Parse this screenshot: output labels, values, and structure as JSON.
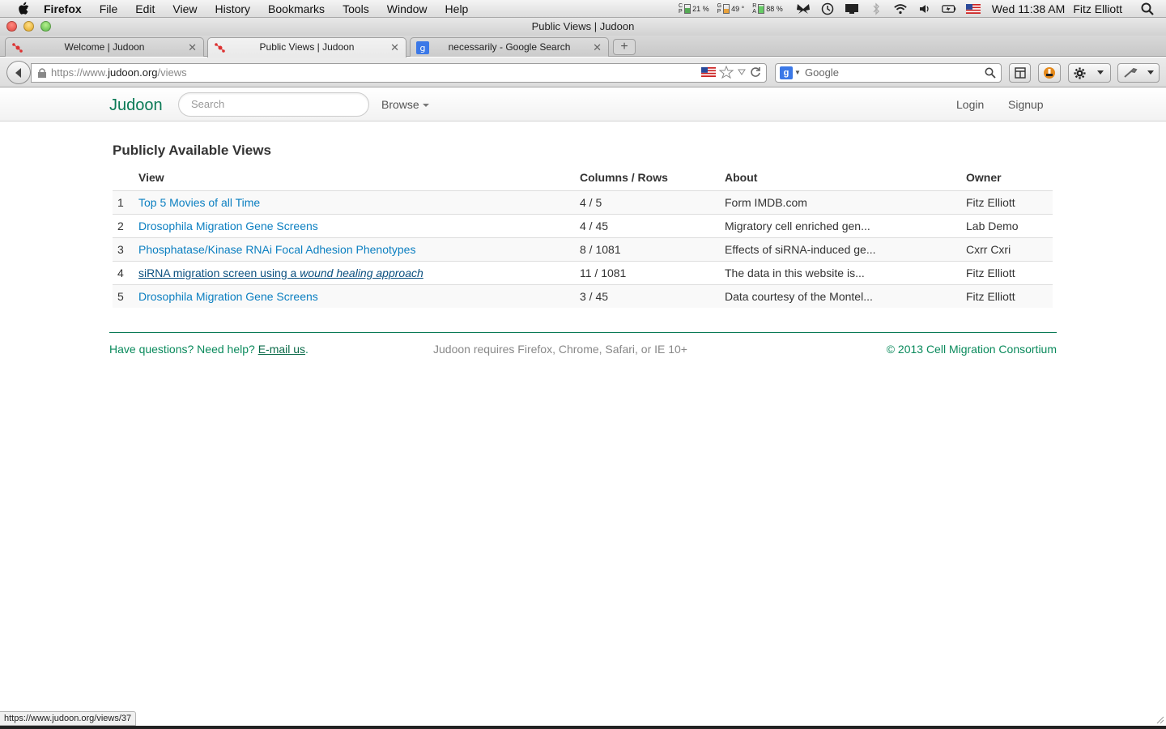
{
  "menubar": {
    "app_name": "Firefox",
    "items": [
      "File",
      "Edit",
      "View",
      "History",
      "Bookmarks",
      "Tools",
      "Window",
      "Help"
    ],
    "cpu": "21 %",
    "temp": "49 °",
    "ram": "88 %",
    "clock": "Wed 11:38 AM",
    "user": "Fitz Elliott"
  },
  "window": {
    "title": "Public Views | Judoon"
  },
  "tabs": [
    {
      "label": "Welcome | Judoon"
    },
    {
      "label": "Public Views | Judoon"
    },
    {
      "label": "necessarily - Google Search"
    }
  ],
  "navbar": {
    "url_scheme": "https://www.",
    "url_host": "judoon.org",
    "url_path": "/views",
    "search_placeholder": "Google"
  },
  "site": {
    "brand": "Judoon",
    "search_placeholder": "Search",
    "browse_label": "Browse",
    "login_label": "Login",
    "signup_label": "Signup"
  },
  "main": {
    "title": "Publicly Available Views",
    "columns": [
      "View",
      "Columns / Rows",
      "About",
      "Owner"
    ],
    "rows": [
      {
        "num": "1",
        "view": "Top 5 Movies of all Time",
        "view_em": "",
        "cr": "4 / 5",
        "about": "Form IMDB.com",
        "owner": "Fitz Elliott"
      },
      {
        "num": "2",
        "view": "Drosophila Migration Gene Screens",
        "view_em": "",
        "cr": "4 / 45",
        "about": "Migratory cell enriched gen...",
        "owner": "Lab Demo"
      },
      {
        "num": "3",
        "view": "Phosphatase/Kinase RNAi Focal Adhesion Phenotypes",
        "view_em": "",
        "cr": "8 / 1081",
        "about": "Effects of siRNA-induced ge...",
        "owner": "Cxrr Cxri"
      },
      {
        "num": "4",
        "view": "siRNA migration screen using a ",
        "view_em": "wound healing approach",
        "cr": "11 / 1081",
        "about": "The data in this website is...",
        "owner": "Fitz Elliott"
      },
      {
        "num": "5",
        "view": "Drosophila Migration Gene Screens",
        "view_em": "",
        "cr": "3 / 45",
        "about": "Data courtesy of the Montel...",
        "owner": "Fitz Elliott"
      }
    ]
  },
  "footer": {
    "help_prefix": "Have questions? Need help? ",
    "email_link": "E-mail us",
    "help_suffix": ".",
    "requirements": "Judoon requires Firefox, Chrome, Safari, or IE 10+",
    "copyright": "© 2013 Cell Migration Consortium"
  },
  "statusbar": {
    "link_url": "https://www.judoon.org/views/37"
  },
  "colors": {
    "brand": "#0a7a56",
    "link": "#0b7fc1",
    "footer_text": "#0a8a5c"
  }
}
